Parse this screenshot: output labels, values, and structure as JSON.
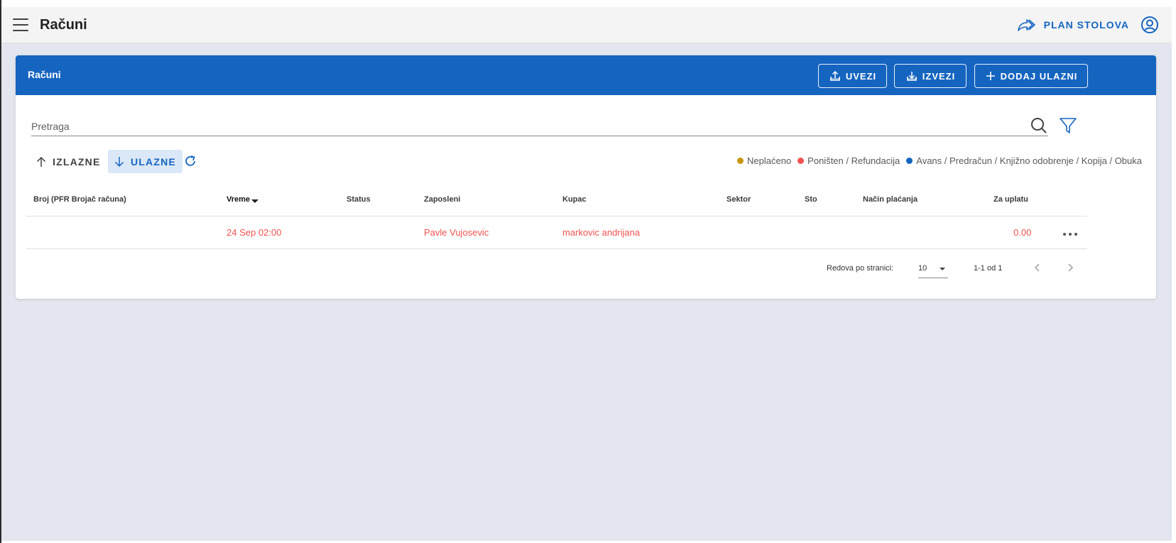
{
  "appbar": {
    "title": "Računi",
    "plan_label": "PLAN STOLOVA"
  },
  "card": {
    "title": "Računi",
    "buttons": {
      "import": "UVEZI",
      "export": "IZVEZI",
      "add": "DODAJ ULAZNI"
    }
  },
  "search": {
    "placeholder": "Pretraga"
  },
  "direction": {
    "outgoing": "IZLAZNE",
    "incoming": "ULAZNE",
    "selected": "ULAZNE"
  },
  "legend": [
    {
      "label": "Neplaćeno",
      "color": "#c7960f"
    },
    {
      "label": "Poništen / Refundacija",
      "color": "#ef5350"
    },
    {
      "label": "Avans / Predračun / Knjižno odobrenje / Kopija / Obuka",
      "color": "#1565c0"
    }
  ],
  "table": {
    "columns": {
      "number": "Broj (PFR Brojač računa)",
      "time": "Vreme",
      "status": "Status",
      "employee": "Zaposleni",
      "customer": "Kupac",
      "sector": "Sektor",
      "table": "Sto",
      "payment": "Način plaćanja",
      "amount": "Za uplatu"
    },
    "rows": [
      {
        "number": "",
        "time": "24 Sep 02:00",
        "status": "",
        "employee": "Pavle Vujosevic",
        "customer": "markovic andrijana",
        "sector": "",
        "table": "",
        "payment": "",
        "amount": "0.00"
      }
    ]
  },
  "pagination": {
    "rows_label": "Redova po stranici:",
    "rows_per_page": "10",
    "range": "1-1 od 1"
  },
  "colors": {
    "primary": "#1565c0",
    "row_text": "#ef5350",
    "background": "#e3e6ee"
  }
}
